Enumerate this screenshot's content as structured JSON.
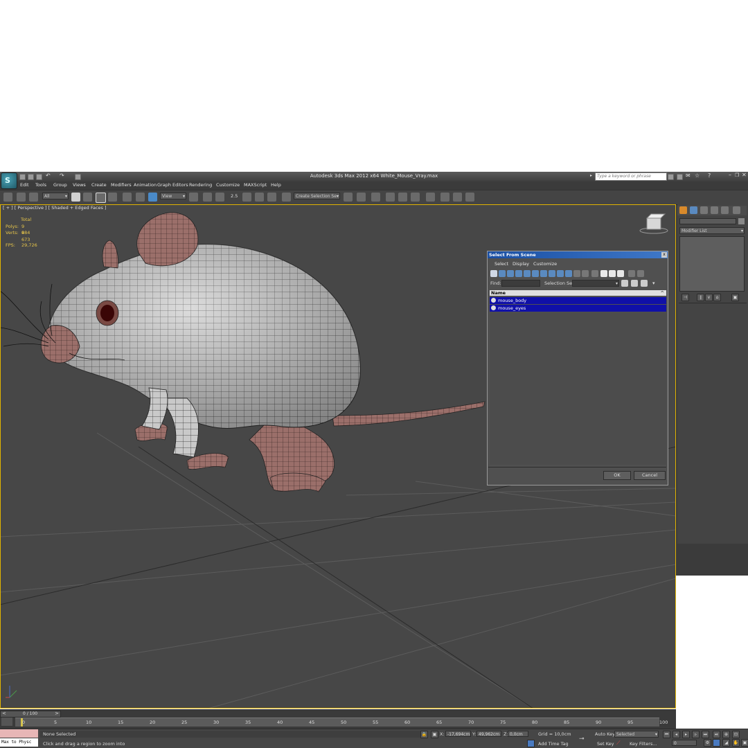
{
  "titlebar": {
    "title": "Autodesk 3ds Max  2012 x64     White_Mouse_Vray.max",
    "search_placeholder": "Type a keyword or phrase"
  },
  "menubar": [
    "Edit",
    "Tools",
    "Group",
    "Views",
    "Create",
    "Modifiers",
    "Animation",
    "Graph Editors",
    "Rendering",
    "Customize",
    "MAXScript",
    "Help"
  ],
  "toolbar": {
    "selection_filter": "All",
    "reference_coord": "View",
    "snap_value": "2.5",
    "named_selection": "Create Selection Se"
  },
  "viewport": {
    "label": "[ + ] [ Perspective ] [ Shaded + Edged Faces ]",
    "stats": {
      "header": "Total",
      "polys_label": "Polys:",
      "polys": "9 484",
      "verts_label": "Verts:",
      "verts": "9 673",
      "fps_label": "FPS:",
      "fps": "29,726"
    }
  },
  "command_panel": {
    "modifier_list": "Modifier List"
  },
  "dialog": {
    "title": "Select From Scene",
    "menu": [
      "Select",
      "Display",
      "Customize"
    ],
    "find_label": "Find:",
    "selection_set_label": "Selection Set:",
    "column_name": "Name",
    "items": [
      "mouse_body",
      "mouse_eyes"
    ],
    "ok": "OK",
    "cancel": "Cancel"
  },
  "timeline": {
    "frame_display": "0 / 100",
    "ticks": [
      "0",
      "5",
      "10",
      "15",
      "20",
      "25",
      "30",
      "35",
      "40",
      "45",
      "50",
      "55",
      "60",
      "65",
      "70",
      "75",
      "80",
      "85",
      "90",
      "95",
      "100"
    ]
  },
  "statusbar": {
    "script_listener": "Max to Physc",
    "selection_status": "None Selected",
    "prompt": "Click and drag a region to zoom into",
    "x_label": "X:",
    "x_value": "-17,694cm",
    "y_label": "Y:",
    "y_value": "49,962cm",
    "z_label": "Z:",
    "z_value": "0,0cm",
    "grid": "Grid = 10,0cm",
    "add_time_tag": "Add Time Tag",
    "auto_key": "Auto Key",
    "auto_key_mode": "Selected",
    "set_key": "Set Key",
    "key_filters": "Key Filters...",
    "current_frame": "0"
  },
  "colors": {
    "selection_blue": "#1010a8",
    "stats_yellow": "#e8c64a",
    "dialog_title": "#1a4fa3"
  }
}
